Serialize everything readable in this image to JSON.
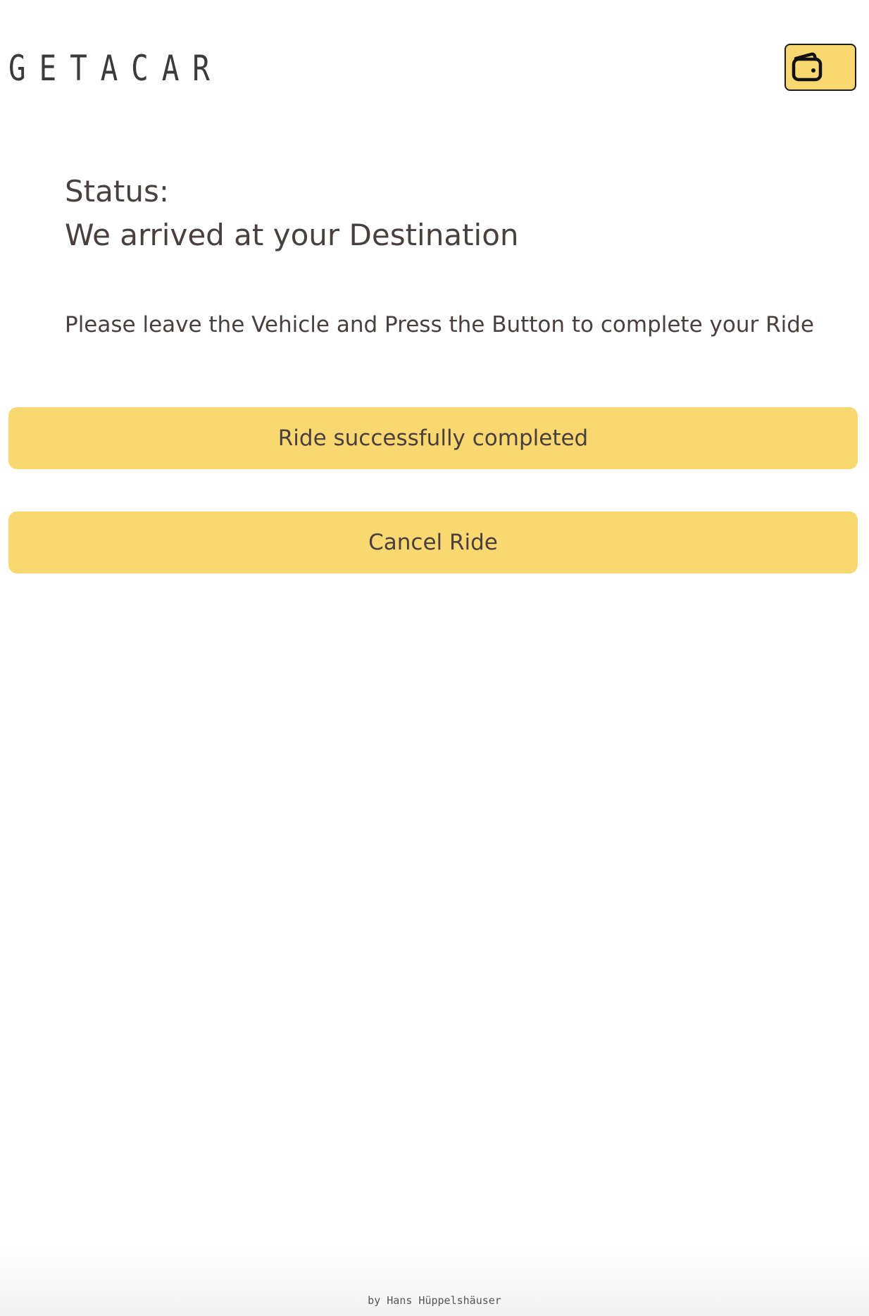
{
  "header": {
    "logo_text": "GETACAR",
    "wallet_button": {
      "icon": "wallet-icon"
    }
  },
  "status": {
    "label": "Status:",
    "message": "We arrived at your Destination"
  },
  "instruction": "Please leave the Vehicle and Press the Button to complete your Ride",
  "buttons": {
    "complete_label": "Ride successfully completed",
    "cancel_label": "Cancel Ride"
  },
  "footer": {
    "credit": "by Hans Hüppelshäuser"
  },
  "colors": {
    "accent": "#f9d871",
    "text": "#4a3f3f",
    "background": "#ffffff"
  }
}
